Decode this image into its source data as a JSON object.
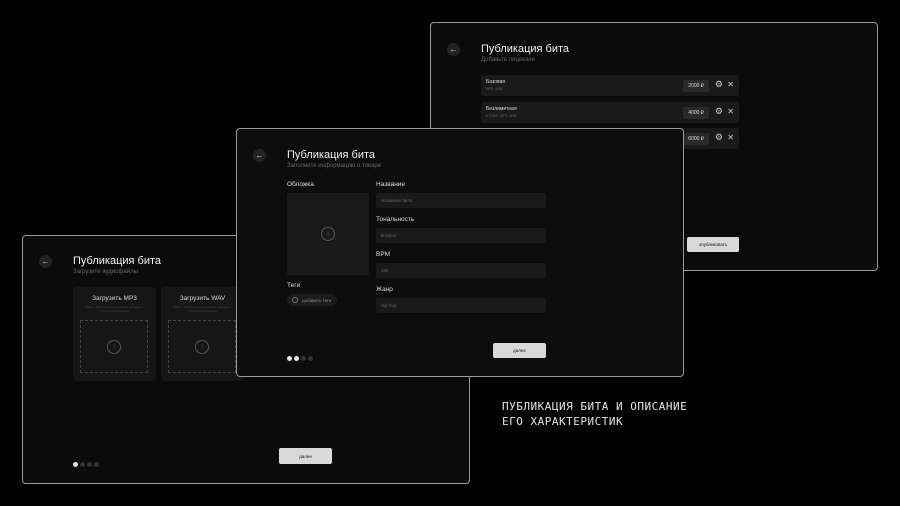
{
  "licenses_screen": {
    "title": "Публикация бита",
    "subtitle": "Добавьте лицензии",
    "licenses": [
      {
        "name": "Базовая",
        "formats": "MP3, WAV",
        "price": "2000 ₽"
      },
      {
        "name": "Безлимитная",
        "formats": "STEMS, MP3, WAV",
        "price": "4000 ₽"
      },
      {
        "name": "",
        "formats": "",
        "price": "6000 ₽"
      }
    ],
    "publish_label": "опубликовать"
  },
  "info_screen": {
    "title": "Публикация бита",
    "subtitle": "Заполните информацию о товаре",
    "cover_label": "Обложка",
    "fields": [
      {
        "label": "Название",
        "placeholder": "Название бита"
      },
      {
        "label": "Тональность",
        "placeholder": "B Minor"
      },
      {
        "label": "BPM",
        "placeholder": "156"
      },
      {
        "label": "Жанр",
        "placeholder": "Hip hop"
      }
    ],
    "tags_label": "Теги",
    "add_tags": "добавить теги",
    "next_label": "далее",
    "step": 2,
    "steps": 4
  },
  "upload_screen": {
    "title": "Публикация бита",
    "subtitle": "Загрузите аудиофайлы",
    "cards": [
      {
        "title": "Загрузить MP3",
        "desc": "Файлы MP3 используются для продажи и предпрослушивания"
      },
      {
        "title": "Загрузить WAV",
        "desc": "Файлы WAV используются для продажи и предпрослушивания"
      }
    ],
    "next_label": "далее",
    "step": 1,
    "steps": 4
  },
  "caption": {
    "line1": "ПУБЛИКАЦИЯ БИТА И ОПИСАНИЕ",
    "line2": "ЕГО ХАРАКТЕРИСТИК"
  }
}
